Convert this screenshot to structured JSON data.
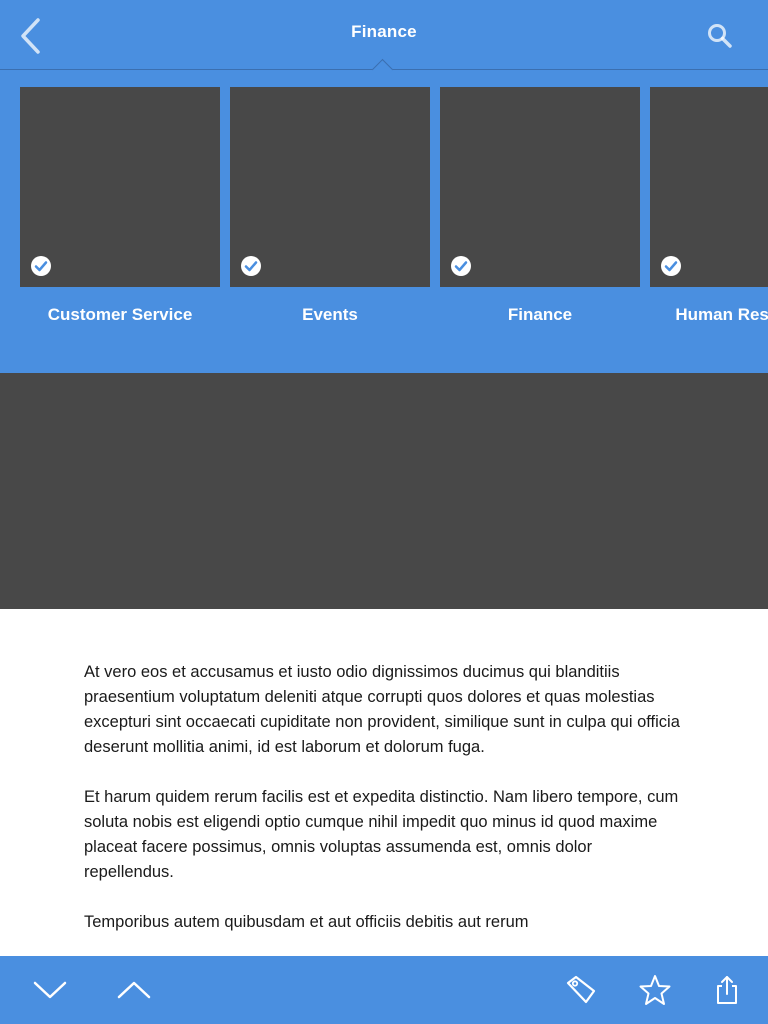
{
  "colors": {
    "accent": "#4a8fe0",
    "placeholder": "#484848",
    "text": "#1a1a1a"
  },
  "nav": {
    "title": "Finance",
    "back_icon": "chevron-left-icon",
    "search_icon": "search-icon"
  },
  "categories": [
    {
      "label": "Customer Service",
      "selected": true
    },
    {
      "label": "Events",
      "selected": true
    },
    {
      "label": "Finance",
      "selected": true
    },
    {
      "label": "Human Resources",
      "selected": true
    }
  ],
  "article": {
    "paragraphs": [
      "At vero eos et accusamus et iusto odio dignissimos ducimus qui blanditiis praesentium voluptatum deleniti atque corrupti quos dolores et quas molestias excepturi sint occaecati cupiditate non provident, similique sunt in culpa qui officia deserunt mollitia animi, id est laborum et dolorum fuga.",
      "Et harum quidem rerum facilis est et expedita distinctio. Nam libero tempore, cum soluta nobis est eligendi optio cumque nihil impedit quo minus id quod maxime placeat facere possimus, omnis voluptas assumenda est, omnis dolor repellendus.",
      "Temporibus autem quibusdam et aut officiis debitis aut rerum"
    ]
  },
  "toolbar": {
    "icons": [
      "chevron-down-icon",
      "chevron-up-icon",
      "tag-icon",
      "star-icon",
      "share-icon"
    ]
  }
}
